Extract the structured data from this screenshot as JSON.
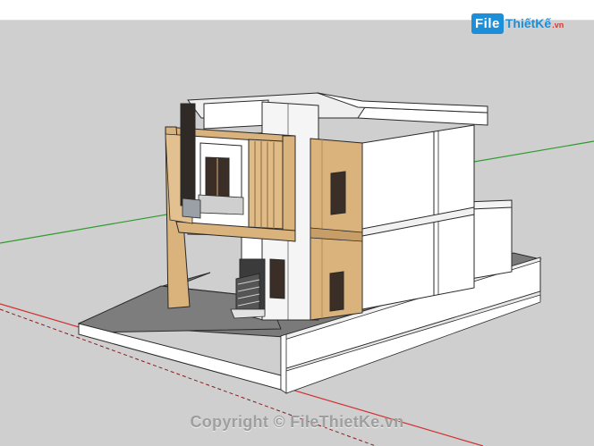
{
  "watermark": {
    "logo_file": "File",
    "logo_rest": "ThiếtKế",
    "logo_tld": ".vn",
    "copyright": "Copyright © FileThietKe.vn"
  },
  "colors": {
    "sky": "#cfcfcf",
    "ground_plate": "#7a7a7a",
    "wall": "#ffffff",
    "wood": "#d9b27c",
    "outline": "#2a2a2a",
    "axis_green": "#2e9a2e",
    "axis_red": "#d23030",
    "logo_blue": "#1d8fd8"
  },
  "icons": {
    "model": "3d-house-model"
  }
}
